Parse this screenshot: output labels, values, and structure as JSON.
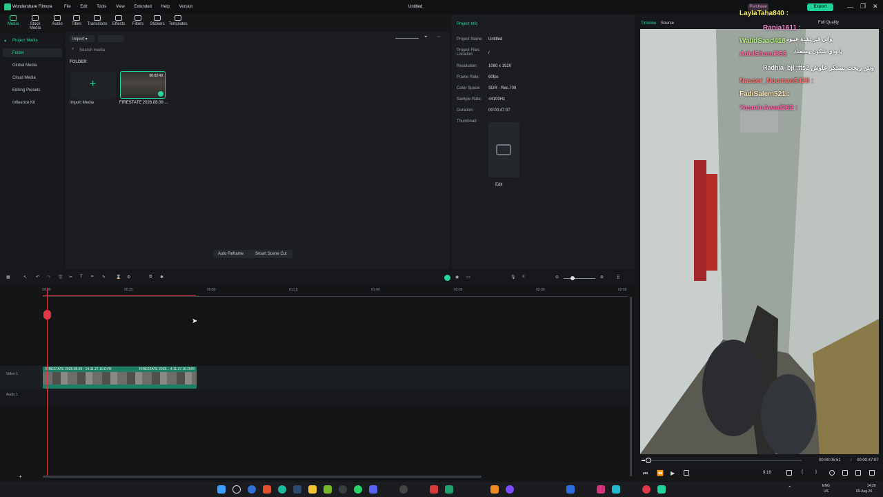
{
  "app": {
    "title": "Wondershare Filmora",
    "document": "Untitled"
  },
  "menu": [
    "File",
    "Edit",
    "Tools",
    "View",
    "Extended",
    "Help",
    "Version"
  ],
  "titlebar_right": {
    "purchase": "Purchase",
    "export": "Export"
  },
  "toolbar": [
    "Media",
    "Stock Media",
    "Audio",
    "Titles",
    "Transitions",
    "Effects",
    "Filters",
    "Stickers",
    "Templates"
  ],
  "leftnav": {
    "project_media": "Project Media",
    "folder": "Folder",
    "items": [
      "Global Media",
      "Cloud Media",
      "Editing Presets",
      "Influence Kit"
    ]
  },
  "media": {
    "import_label": "Import",
    "search_placeholder": "Search media",
    "folder_heading": "FOLDER",
    "import_media": "Import Media",
    "clip_name": "FIRESTATE 2026.08.09 ...",
    "clip_duration": "00:02:49",
    "auto_reframe": "Auto Reframe",
    "smart_scene_cut": "Smart Scene Cut"
  },
  "project_info": {
    "heading": "Project Info",
    "rows": [
      {
        "label": "Project Name:",
        "value": "Untitled"
      },
      {
        "label": "Project Files Location:",
        "value": "/"
      },
      {
        "label": "Resolution:",
        "value": "1080 x 1920"
      },
      {
        "label": "Frame Rate:",
        "value": "60fps"
      },
      {
        "label": "Color Space:",
        "value": "SDR - Rec.709"
      },
      {
        "label": "Sample Rate:",
        "value": "44100Hz"
      },
      {
        "label": "Duration:",
        "value": "00:00:47:07"
      },
      {
        "label": "Thumbnail:",
        "value": ""
      }
    ],
    "edit": "Edit"
  },
  "preview": {
    "tabs": [
      "Timeline",
      "Source"
    ],
    "quality": "Full Quality",
    "current_time": "00:00:05:51",
    "total_time": "00:00:47:07",
    "zoom": "9:16",
    "progress": 0.02
  },
  "chat": [
    {
      "user": "LaylaTaha840 :",
      "color": "#f4f060"
    },
    {
      "user": "Rania1611 :",
      "color": "#f48fd0"
    },
    {
      "user": "واتي قير تشتة عيبوه",
      "color": "#ffffff"
    },
    {
      "user": "WalidSaad418",
      "color": "#b6f07c"
    },
    {
      "user": "يا ودي شكون يستعنك",
      "color": "#ffffff"
    },
    {
      "user": "AdelShami855",
      "color": "#ff6aa0"
    },
    {
      "user": "Radhia_bjl :tts2 وش ربحت بستكر علوش",
      "color": "#ffffff"
    },
    {
      "user": "Nasser_Nouman5428 :",
      "color": "#ff7070"
    },
    {
      "user": "FadiSalem521 :",
      "color": "#ffe7b0"
    },
    {
      "user": "YasminAwad262 :",
      "color": "#ff5fa0"
    }
  ],
  "timeline": {
    "ruler": [
      "00:00",
      "00:25",
      "00:50",
      "01:15",
      "01:40",
      "02:05",
      "02:30",
      "02:55"
    ],
    "video_track": "Video 1",
    "audio_track": "Audio 1",
    "clip_a": "FIRESTATE 2026.08.09 - 14.11.27.10.DVR",
    "clip_b": "FIRESTATE 2026....4.11.27.10.DVR"
  },
  "taskbar": {
    "lang": "ENG",
    "region": "US",
    "time": "14:20",
    "date": "09-Aug-26"
  }
}
